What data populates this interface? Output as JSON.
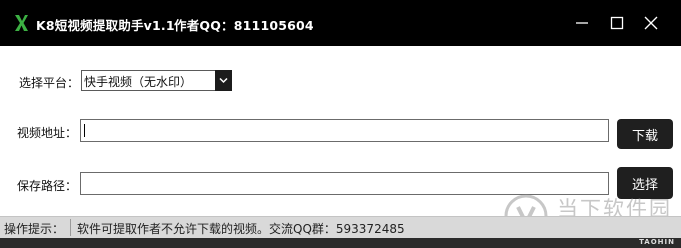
{
  "titlebar": {
    "app_title": "K8短视频提取助手v1.1",
    "author": "作者QQ：811105604",
    "background": "#000000"
  },
  "form": {
    "platform_label": "选择平台：",
    "platform_selected": "快手视频（无水印）",
    "url_label": "视频地址：",
    "url_value": "",
    "download_button": "下载",
    "path_label": "保存路径：",
    "path_value": "",
    "choose_button": "选择"
  },
  "status": {
    "label": "操作提示：",
    "text": "软件可提取作者不允许下载的视频。交流QQ群：593372485"
  },
  "footer_tag": "TAOHIN",
  "watermark": {
    "text": "当下软件园",
    "url": "www.downxia.com"
  },
  "icons": {
    "logo": "k8-logo-icon",
    "minimize": "minimize-icon",
    "maximize": "maximize-icon",
    "close": "close-icon",
    "dropdown": "chevron-down-icon",
    "watermark": "watermark-logo-icon"
  },
  "colors": {
    "accent": "#3cb043",
    "button": "#1f1f1f",
    "statusbar": "#d9d9d9"
  }
}
